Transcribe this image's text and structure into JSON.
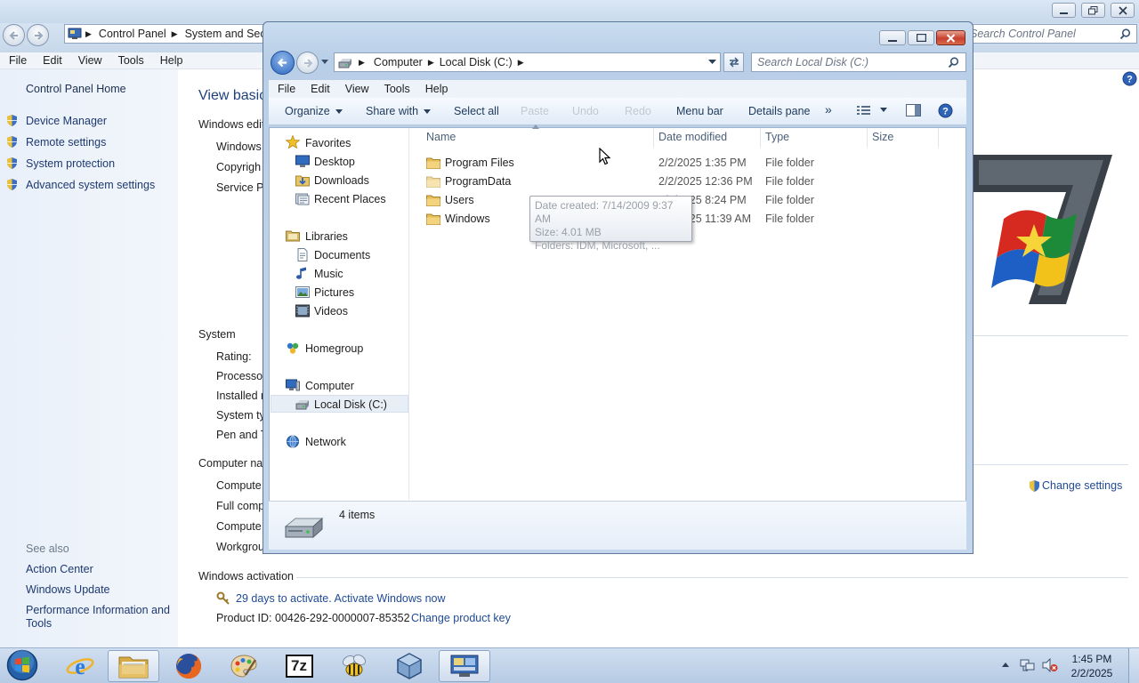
{
  "control_panel": {
    "address": {
      "segment1": "Control Panel",
      "segment2": "System and Secu"
    },
    "search_placeholder": "Search Control Panel",
    "menu": [
      "File",
      "Edit",
      "View",
      "Tools",
      "Help"
    ],
    "left_nav": {
      "home": "Control Panel Home",
      "links": [
        "Device Manager",
        "Remote settings",
        "System protection",
        "Advanced system settings"
      ],
      "see_also_heading": "See also",
      "see_also": [
        "Action Center",
        "Windows Update",
        "Performance Information and Tools"
      ]
    },
    "main": {
      "title": "View basic",
      "edition_heading": "Windows edit",
      "edition_rows": [
        "Windows",
        "Copyrigh",
        "Service Pa"
      ],
      "system_heading": "System",
      "system_rows": [
        "Rating:",
        "Processor",
        "Installed r",
        "System ty",
        "Pen and T"
      ],
      "computer_heading": "Computer na",
      "computer_rows": [
        "Compute",
        "Full comp",
        "Compute",
        "Workgrou"
      ],
      "change_settings": "Change settings",
      "activation_heading": "Windows activation",
      "activation_link": "29 days to activate. Activate Windows now",
      "product_id": "Product ID: 00426-292-0000007-85352",
      "change_product_key": "Change product key"
    }
  },
  "explorer": {
    "address": {
      "segment1": "Computer",
      "segment2": "Local Disk (C:)"
    },
    "search_placeholder": "Search Local Disk (C:)",
    "menu": [
      "File",
      "Edit",
      "View",
      "Tools",
      "Help"
    ],
    "toolbar": {
      "organize": "Organize",
      "share_with": "Share with",
      "select_all": "Select all",
      "paste": "Paste",
      "undo": "Undo",
      "redo": "Redo",
      "menu_bar": "Menu bar",
      "details_pane": "Details pane",
      "more": "»"
    },
    "nav": {
      "favorites": "Favorites",
      "favorites_items": [
        "Desktop",
        "Downloads",
        "Recent Places"
      ],
      "libraries": "Libraries",
      "libraries_items": [
        "Documents",
        "Music",
        "Pictures",
        "Videos"
      ],
      "homegroup": "Homegroup",
      "computer": "Computer",
      "local_disk": "Local Disk (C:)",
      "network": "Network"
    },
    "columns": {
      "name": "Name",
      "date": "Date modified",
      "type": "Type",
      "size": "Size"
    },
    "files": [
      {
        "name": "Program Files",
        "date": "2/2/2025 1:35 PM",
        "type": "File folder"
      },
      {
        "name": "ProgramData",
        "date": "2/2/2025 12:36 PM",
        "type": "File folder"
      },
      {
        "name": "Users",
        "date": "2/2/2025 8:24 PM",
        "type": "File folder"
      },
      {
        "name": "Windows",
        "date": "2/2/2025 11:39 AM",
        "type": "File folder"
      }
    ],
    "tooltip": {
      "created": "Date created: 7/14/2009 9:37 AM",
      "size": "Size: 4.01 MB",
      "folders": "Folders: IDM, Microsoft, ..."
    },
    "details_count": "4 items"
  },
  "taskbar": {
    "icons": [
      "start-orb-icon",
      "internet-explorer-icon",
      "windows-explorer-icon",
      "firefox-icon",
      "paint-icon",
      "7zip-icon",
      "bee-app-icon",
      "virtualbox-icon",
      "control-panel-icon"
    ],
    "seven_zip_label": "7z",
    "time": "1:45 PM",
    "date": "2/2/2025"
  },
  "colors": {
    "accent": "#1f4a95",
    "titlebar": "#c8d9ec",
    "taskbar": "#b6cbe4",
    "close": "#c94030"
  }
}
